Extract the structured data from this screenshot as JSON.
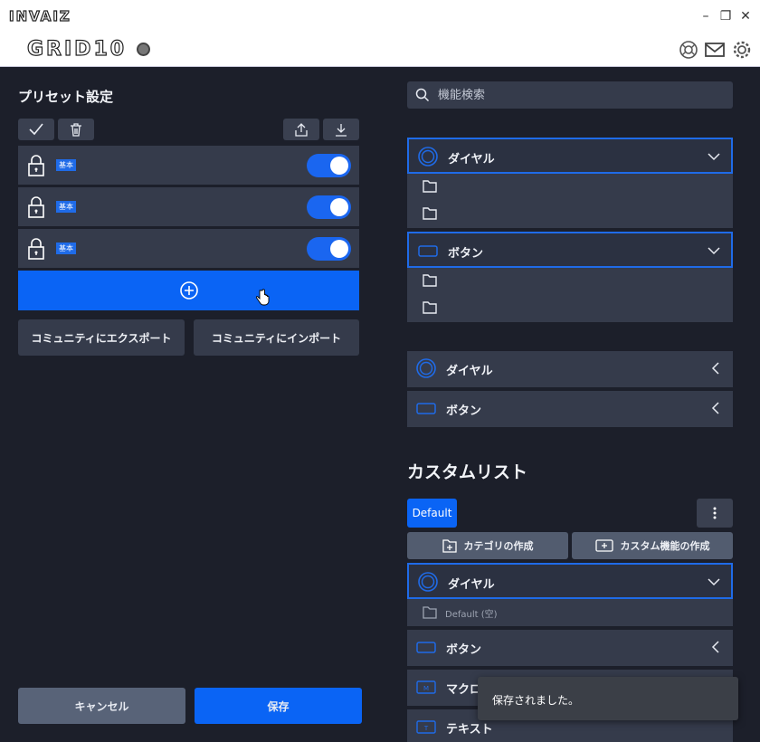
{
  "window": {
    "brand": "INVAIZ",
    "product": "GRID10",
    "controls": {
      "minimize": "–",
      "maximize": "❐",
      "close": "✕"
    }
  },
  "left_panel": {
    "title": "プリセット設定",
    "presets": [
      {
        "tag": "基本",
        "enabled": true
      },
      {
        "tag": "基本",
        "enabled": true
      },
      {
        "tag": "基本",
        "enabled": true
      }
    ],
    "export_label": "コミュニティにエクスポート",
    "import_label": "コミュニティにインポート",
    "cancel_label": "キャンセル",
    "save_label": "保存"
  },
  "right_panel": {
    "search": {
      "placeholder": "機能検索"
    },
    "categories": [
      {
        "label": "ダイヤル",
        "icon": "dial-icon",
        "expanded": true
      },
      {
        "label": "ボタン",
        "icon": "button-icon",
        "expanded": true
      },
      {
        "label": "ダイヤル",
        "icon": "dial-icon",
        "expanded": false
      },
      {
        "label": "ボタン",
        "icon": "button-icon",
        "expanded": false
      }
    ],
    "custom_list": {
      "title": "カスタムリスト",
      "tab_default": "Default",
      "create_category_label": "カテゴリの作成",
      "create_function_label": "カスタム機能の作成",
      "items": [
        {
          "label": "ダイヤル",
          "icon": "dial-icon",
          "expanded": true
        },
        {
          "label": "Default (空)",
          "icon": "folder-icon"
        },
        {
          "label": "ボタン",
          "icon": "button-icon",
          "expanded": false
        },
        {
          "label": "マクロ",
          "icon": "macro-icon",
          "expanded": false
        },
        {
          "label": "テキスト",
          "icon": "text-icon",
          "expanded": false
        }
      ]
    }
  },
  "toast": {
    "message": "保存されました。"
  },
  "colors": {
    "accent": "#0a64f5",
    "panel": "#353b4b",
    "background": "#1c1f2a"
  }
}
